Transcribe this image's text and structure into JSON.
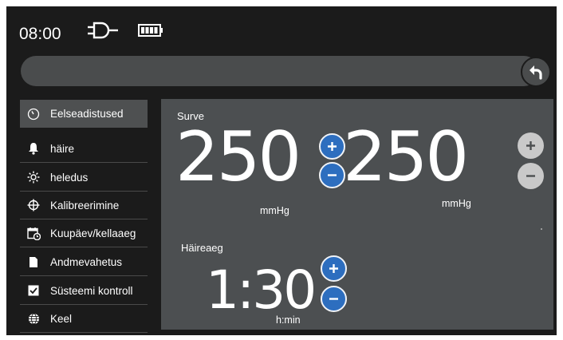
{
  "status": {
    "time": "08:00",
    "icons": [
      "plug-icon",
      "battery-icon"
    ]
  },
  "navigation": {
    "back_icon": "back-arrow-icon"
  },
  "sidebar": {
    "items": [
      {
        "label": "Eelseadistused",
        "icon": "gauge-icon",
        "active": true
      },
      {
        "label": "häire",
        "icon": "bell-icon",
        "active": false
      },
      {
        "label": "heledus",
        "icon": "brightness-icon",
        "active": false
      },
      {
        "label": "Kalibreerimine",
        "icon": "crosshair-icon",
        "active": false
      },
      {
        "label": "Kuupäev/kellaaeg",
        "icon": "calendar-clock-icon",
        "active": false
      },
      {
        "label": "Andmevahetus",
        "icon": "sd-card-icon",
        "active": false
      },
      {
        "label": "Süsteemi kontroll",
        "icon": "checkbox-icon",
        "active": false
      },
      {
        "label": "Keel",
        "icon": "globe-icon",
        "active": false
      }
    ]
  },
  "main": {
    "pressure": {
      "label": "Surve",
      "left_value": "250",
      "left_unit": "mmHg",
      "right_value": "250",
      "right_unit": "mmHg"
    },
    "alarm_time": {
      "label": "Häireaeg",
      "value": "1:30",
      "unit": "h:min"
    }
  },
  "colors": {
    "background": "#1b1b1b",
    "panel": "#4c4f51",
    "accent_blue": "#2d6ebf",
    "disabled_grey": "#c9c9c9"
  }
}
